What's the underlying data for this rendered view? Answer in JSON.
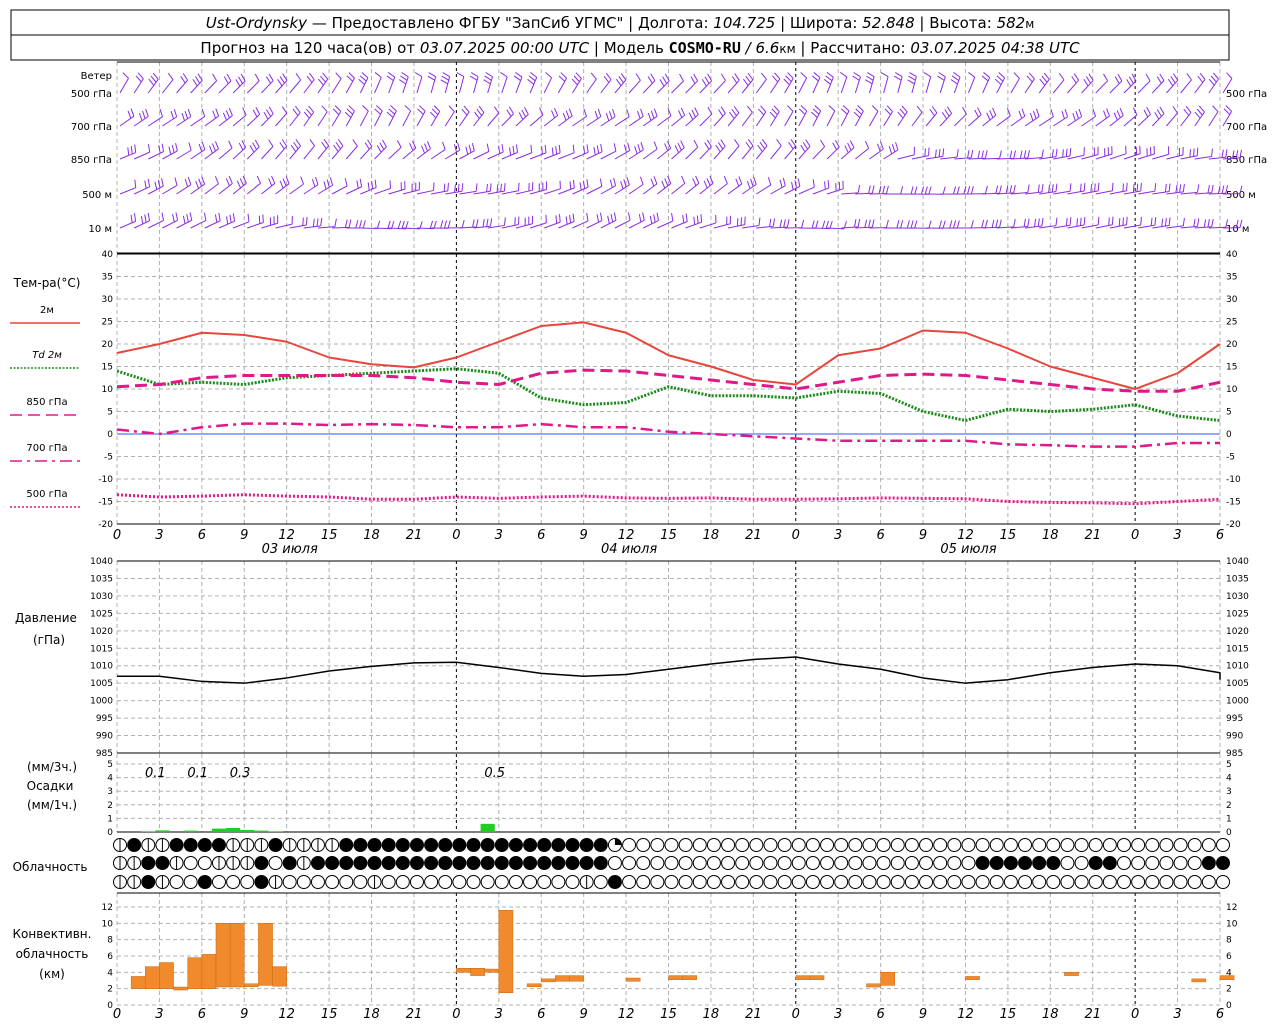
{
  "header": {
    "station": "Ust-Ordynsky",
    "provider": " — Предоставлено ФГБУ \"ЗапСиб УГМС\" | Долгота: ",
    "lon": "104.725",
    "lat_label": " | Широта: ",
    "lat": "52.848",
    "alt_label": " | Высота: ",
    "alt": "582",
    "alt_unit": "м",
    "forecast_label": "Прогноз на 120 часа(ов) от ",
    "start": "03.07.2025 00:00 UTC",
    "model_label": " | Модель ",
    "model": "COSMO-RU",
    "res": " / 6.6",
    "res_unit": "км",
    "calc_label": " | Рассчитано: ",
    "calc": "03.07.2025 04:38 UTC"
  },
  "x_ticks": [
    "0",
    "3",
    "6",
    "9",
    "12",
    "15",
    "18",
    "21",
    "0",
    "3",
    "6",
    "9",
    "12",
    "15",
    "18",
    "21",
    "0",
    "3",
    "6",
    "9",
    "12",
    "15",
    "18",
    "21",
    "0",
    "3",
    "6"
  ],
  "days": [
    "03 июля",
    "04 июля",
    "05 июля"
  ],
  "wind": {
    "title": "Ветер",
    "levels": [
      "500 гПа",
      "700 гПа",
      "850 гПа",
      "500 м",
      "10  м"
    ],
    "color": "#8a2be2"
  },
  "temp": {
    "title": "Тем-ра(°C)",
    "legend": [
      {
        "label": "2м",
        "color": "#e8463c",
        "style": "solid"
      },
      {
        "label": "Td  2м",
        "color": "#1b8a1b",
        "style": "dotted"
      },
      {
        "label": "850 гПа",
        "color": "#e0198a",
        "style": "dash"
      },
      {
        "label": "700 гПа",
        "color": "#e0198a",
        "style": "dashdot"
      },
      {
        "label": "500 гПа",
        "color": "#e0198a",
        "style": "dot"
      }
    ],
    "yticks": [
      "40",
      "35",
      "30",
      "25",
      "20",
      "15",
      "10",
      "5",
      "0",
      "-5",
      "-10",
      "-15",
      "-20"
    ]
  },
  "pressure": {
    "title": "Давление",
    "unit": "(гПа)",
    "yticks": [
      "1040",
      "1035",
      "1030",
      "1025",
      "1020",
      "1015",
      "1010",
      "1005",
      "1000",
      "995",
      "990",
      "985"
    ]
  },
  "precip": {
    "label1": "(мм/3ч.)",
    "label2": "Осадки",
    "label3": "(мм/1ч.)",
    "yticks": [
      "5",
      "4",
      "3",
      "2",
      "1",
      "0"
    ],
    "amounts": [
      {
        "text": "0.1",
        "hour": 2
      },
      {
        "text": "0.1",
        "hour": 5
      },
      {
        "text": "0.3",
        "hour": 8
      },
      {
        "text": "0.5",
        "hour": 26
      }
    ]
  },
  "clouds": {
    "title": "Облачность"
  },
  "convective": {
    "title1": "Конвективн.",
    "title2": "облачность",
    "title3": "(км)",
    "yticks": [
      "12",
      "10",
      "8",
      "6",
      "4",
      "2",
      "0"
    ],
    "color": "#f08a2c"
  },
  "chart_data": [
    {
      "type": "line",
      "title": "Тем-ра(°C)",
      "x_unit": "hours since 03.07.2025 00:00 UTC",
      "ylim": [
        -20,
        40
      ],
      "x": [
        0,
        3,
        6,
        9,
        12,
        15,
        18,
        21,
        24,
        27,
        30,
        33,
        36,
        39,
        42,
        45,
        48,
        51,
        54,
        57,
        60,
        63,
        66,
        69,
        72,
        75,
        78
      ],
      "series": [
        {
          "name": "2м",
          "values": [
            18,
            20,
            22.5,
            22,
            20.5,
            17,
            15.5,
            14.8,
            17,
            20.5,
            24,
            24.8,
            22.5,
            17.5,
            15,
            12,
            11,
            17.5,
            19,
            23,
            22.5,
            19,
            15,
            12.5,
            10,
            13.5,
            20
          ]
        },
        {
          "name": "Td  2м",
          "values": [
            14,
            11,
            11.5,
            11,
            12.5,
            13,
            13.5,
            14,
            14.5,
            13.5,
            8,
            6.5,
            7,
            10.5,
            8.5,
            8.5,
            8,
            9.5,
            9,
            5,
            3,
            5.5,
            5,
            5.5,
            6.5,
            4,
            3
          ]
        },
        {
          "name": "850 гПа",
          "values": [
            10.5,
            11,
            12.5,
            13,
            13,
            13,
            13,
            12.5,
            11.5,
            11,
            13.5,
            14.2,
            14,
            13,
            12,
            11,
            10,
            11.5,
            13,
            13.3,
            13,
            12,
            11,
            10,
            9.5,
            9.5,
            11.5
          ]
        },
        {
          "name": "700 гПа",
          "values": [
            1,
            0,
            1.5,
            2.3,
            2.3,
            2,
            2.2,
            2,
            1.5,
            1.5,
            2.2,
            1.5,
            1.5,
            0.5,
            0,
            -0.5,
            -1,
            -1.5,
            -1.5,
            -1.5,
            -1.5,
            -2.3,
            -2.5,
            -2.8,
            -2.8,
            -2,
            -2
          ]
        },
        {
          "name": "500 гПа",
          "values": [
            -13.5,
            -14,
            -13.8,
            -13.5,
            -13.8,
            -14,
            -14.5,
            -14.5,
            -14,
            -14.3,
            -14,
            -13.8,
            -14.2,
            -14.3,
            -14.2,
            -14.5,
            -14.5,
            -14.4,
            -14.2,
            -14.3,
            -14.4,
            -15,
            -15.2,
            -15.3,
            -15.5,
            -15,
            -14.5
          ]
        }
      ]
    },
    {
      "type": "line",
      "title": "Давление",
      "x_unit": "hours since 03.07.2025 00:00 UTC",
      "ylim": [
        985,
        1040
      ],
      "x": [
        0,
        3,
        6,
        9,
        12,
        15,
        18,
        21,
        24,
        27,
        30,
        33,
        36,
        39,
        42,
        45,
        48,
        51,
        54,
        57,
        60,
        63,
        66,
        69,
        72,
        75,
        78
      ],
      "series": [
        {
          "name": "Давление",
          "values": [
            1007,
            1007,
            1005.5,
            1005,
            1006.5,
            1008.5,
            1009.8,
            1010.8,
            1011,
            1009.5,
            1007.8,
            1007,
            1007.5,
            1009,
            1010.5,
            1011.8,
            1012.5,
            1010.5,
            1009,
            1006.5,
            1005,
            1006,
            1008,
            1009.5,
            1010.5,
            1010,
            1008,
            1006
          ]
        }
      ]
    },
    {
      "type": "bar",
      "title": "Осадки (мм/1ч.)",
      "x": [
        2,
        3,
        5,
        7,
        8,
        9,
        10,
        11,
        26
      ],
      "values": [
        0.05,
        0.12,
        0.1,
        0.25,
        0.3,
        0.15,
        0.1,
        0.05,
        0.6
      ],
      "ylim": [
        0,
        5
      ]
    },
    {
      "type": "bar",
      "title": "Конвективн. облачность (км)",
      "ylim": [
        0,
        12
      ],
      "bars": [
        {
          "x": 1.5,
          "base": 2,
          "top": 3.5
        },
        {
          "x": 2.5,
          "base": 2,
          "top": 4.7
        },
        {
          "x": 3.5,
          "base": 2,
          "top": 5.2
        },
        {
          "x": 4.5,
          "base": 2,
          "top": 2.2
        },
        {
          "x": 5.5,
          "base": 2,
          "top": 5.8
        },
        {
          "x": 6.5,
          "base": 2,
          "top": 6.2
        },
        {
          "x": 7.5,
          "base": 2.2,
          "top": 10
        },
        {
          "x": 8.5,
          "base": 2.2,
          "top": 10
        },
        {
          "x": 9.5,
          "base": 2.4,
          "top": 2.6
        },
        {
          "x": 10.5,
          "base": 2.4,
          "top": 10
        },
        {
          "x": 11.5,
          "base": 2.3,
          "top": 4.7
        },
        {
          "x": 24.5,
          "base": 4,
          "top": 4.5
        },
        {
          "x": 25.5,
          "base": 3.6,
          "top": 4.5
        },
        {
          "x": 26.5,
          "base": 4,
          "top": 4.4
        },
        {
          "x": 27.5,
          "base": 1.5,
          "top": 11.6
        },
        {
          "x": 29.5,
          "base": 2.3,
          "top": 2.6
        },
        {
          "x": 30.5,
          "base": 2.9,
          "top": 3.2
        },
        {
          "x": 31.5,
          "base": 2.9,
          "top": 3.6
        },
        {
          "x": 32.5,
          "base": 2.9,
          "top": 3.6
        },
        {
          "x": 36.5,
          "base": 2.9,
          "top": 3.3
        },
        {
          "x": 39.5,
          "base": 3.1,
          "top": 3.6
        },
        {
          "x": 40.5,
          "base": 3.1,
          "top": 3.6
        },
        {
          "x": 48.5,
          "base": 3.1,
          "top": 3.6
        },
        {
          "x": 49.5,
          "base": 3.1,
          "top": 3.6
        },
        {
          "x": 53.5,
          "base": 2.2,
          "top": 2.6
        },
        {
          "x": 54.5,
          "base": 2.4,
          "top": 4
        },
        {
          "x": 60.5,
          "base": 3.1,
          "top": 3.5
        },
        {
          "x": 67.5,
          "base": 3.6,
          "top": 4
        },
        {
          "x": 76.5,
          "base": 2.9,
          "top": 3.2
        },
        {
          "x": 78.5,
          "base": 3.1,
          "top": 3.6
        }
      ]
    }
  ]
}
